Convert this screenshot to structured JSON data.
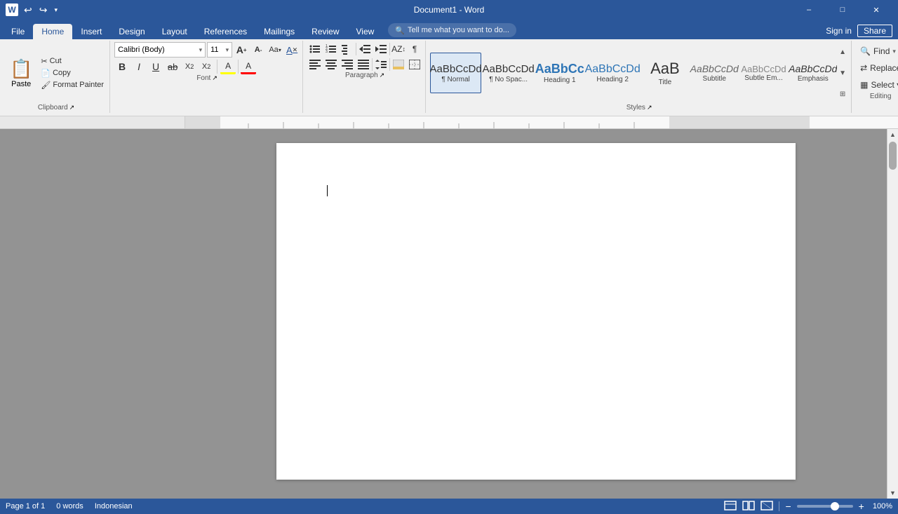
{
  "titlebar": {
    "title": "Document1 - Word",
    "app_icon": "W",
    "min_label": "–",
    "max_label": "□",
    "close_label": "✕",
    "undo_label": "↩",
    "redo_label": "↪"
  },
  "tabs": [
    {
      "label": "File",
      "active": false
    },
    {
      "label": "Home",
      "active": true
    },
    {
      "label": "Insert",
      "active": false
    },
    {
      "label": "Design",
      "active": false
    },
    {
      "label": "Layout",
      "active": false
    },
    {
      "label": "References",
      "active": false
    },
    {
      "label": "Mailings",
      "active": false
    },
    {
      "label": "Review",
      "active": false
    },
    {
      "label": "View",
      "active": false
    }
  ],
  "tell_me": "Tell me what you want to do...",
  "sign_in": "Sign in",
  "share": "Share",
  "clipboard": {
    "label": "Clipboard",
    "paste_label": "Paste",
    "cut_label": "Cut",
    "copy_label": "Copy",
    "format_painter_label": "Format Painter"
  },
  "font": {
    "label": "Font",
    "font_name": "Calibri (Body)",
    "font_size": "11",
    "bold": "B",
    "italic": "I",
    "underline": "U",
    "strikethrough": "ab",
    "subscript": "X₂",
    "superscript": "X²",
    "grow": "A",
    "shrink": "a",
    "change_case": "Aa",
    "clear_format": "A",
    "highlight": "A",
    "color": "A"
  },
  "paragraph": {
    "label": "Paragraph",
    "bullets": "≡",
    "numbering": "≡",
    "multilevel": "≡",
    "decrease_indent": "⇤",
    "increase_indent": "⇥",
    "sort": "↕",
    "show_marks": "¶",
    "align_left": "≡",
    "align_center": "≡",
    "align_right": "≡",
    "justify": "≡",
    "line_spacing": "↕",
    "shading": "A",
    "borders": "□"
  },
  "styles": {
    "label": "Styles",
    "items": [
      {
        "sample": "AaBbCcDd",
        "label": "Normal",
        "class": "s-normal",
        "active": true
      },
      {
        "sample": "AaBbCcDd",
        "label": "No Spac...",
        "class": "s-nospace",
        "active": false
      },
      {
        "sample": "AaBbCc",
        "label": "Heading 1",
        "class": "s-h1",
        "active": false
      },
      {
        "sample": "AaBbCcDd",
        "label": "Heading 2",
        "class": "s-h2",
        "active": false
      },
      {
        "sample": "AaB",
        "label": "Title",
        "class": "s-title",
        "active": false
      },
      {
        "sample": "AaBbCcDd",
        "label": "Subtitle",
        "class": "s-subtitle",
        "active": false
      },
      {
        "sample": "AaBbCcDd",
        "label": "Subtle Em...",
        "class": "s-subtle",
        "active": false
      },
      {
        "sample": "AaBbCcDd",
        "label": "Emphasis",
        "class": "s-emphasis",
        "active": false
      }
    ]
  },
  "editing": {
    "label": "Editing",
    "find_label": "Find",
    "replace_label": "Replace",
    "select_label": "Select ▾"
  },
  "document": {
    "text": "",
    "page_info": "Page 1 of 1",
    "word_count": "0 words",
    "language": "Indonesian"
  },
  "status": {
    "page_info": "Page 1 of 1",
    "words": "0 words",
    "language": "Indonesian",
    "zoom": "100%"
  }
}
